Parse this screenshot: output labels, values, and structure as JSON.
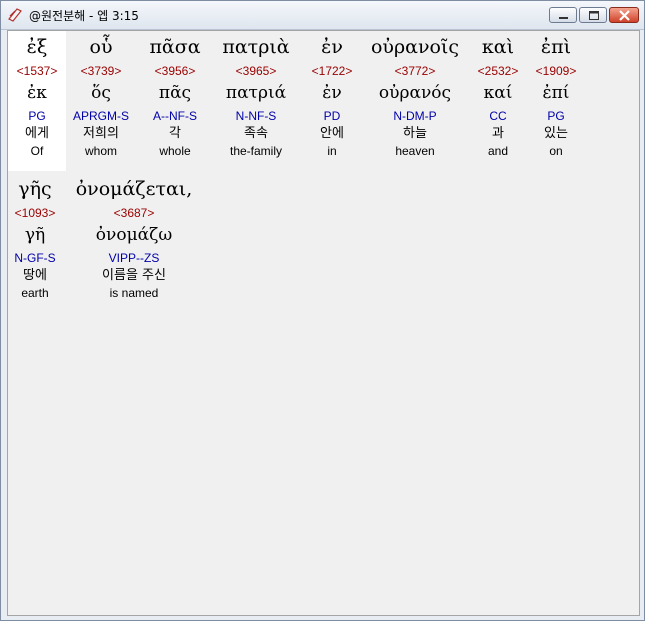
{
  "window": {
    "title": "@원전분해 - 엡 3:15",
    "buttons": [
      "minimize",
      "maximize",
      "close"
    ]
  },
  "words": [
    {
      "greek": "ἐξ",
      "strong": "<1537>",
      "lemma": "ἐκ",
      "parse": "PG",
      "korean": "에게",
      "english": "Of",
      "selected": true
    },
    {
      "greek": "οὗ",
      "strong": "<3739>",
      "lemma": "ὅς",
      "parse": "APRGM-S",
      "korean": "저희의",
      "english": "whom"
    },
    {
      "greek": "πᾶσα",
      "strong": "<3956>",
      "lemma": "πᾶς",
      "parse": "A--NF-S",
      "korean": "각",
      "english": "whole"
    },
    {
      "greek": "πατριὰ",
      "strong": "<3965>",
      "lemma": "πατριά",
      "parse": "N-NF-S",
      "korean": "족속",
      "english": "the-family"
    },
    {
      "greek": "ἐν",
      "strong": "<1722>",
      "lemma": "ἐν",
      "parse": "PD",
      "korean": "안에",
      "english": "in"
    },
    {
      "greek": "οὐρανοῖς",
      "strong": "<3772>",
      "lemma": "οὐρανός",
      "parse": "N-DM-P",
      "korean": "하늘",
      "english": "heaven"
    },
    {
      "greek": "καὶ",
      "strong": "<2532>",
      "lemma": "καί",
      "parse": "CC",
      "korean": "과",
      "english": "and"
    },
    {
      "greek": "ἐπὶ",
      "strong": "<1909>",
      "lemma": "ἐπί",
      "parse": "PG",
      "korean": "있는",
      "english": "on"
    },
    {
      "greek": "γῆς",
      "strong": "<1093>",
      "lemma": "γῆ",
      "parse": "N-GF-S",
      "korean": "땅에",
      "english": "earth"
    },
    {
      "greek": "ὀνομάζεται,",
      "strong": "<3687>",
      "lemma": "ὀνομάζω",
      "parse": "VIPP--ZS",
      "korean": "이름을 주신",
      "english": "is named"
    }
  ]
}
